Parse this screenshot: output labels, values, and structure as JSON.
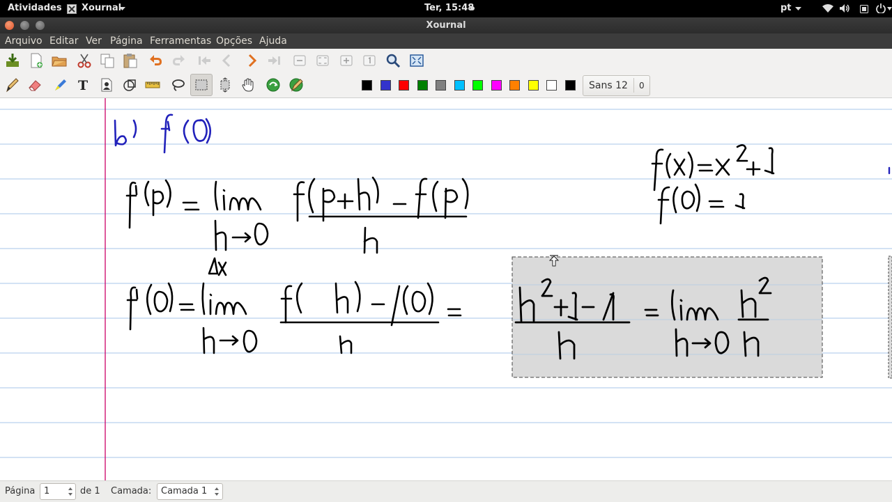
{
  "topbar": {
    "activities": "Atividades",
    "app_menu": "Xournal",
    "clock": "Ter, 15:48",
    "lang": "pt"
  },
  "window": {
    "title": "Xournal"
  },
  "menubar": {
    "items": [
      "Arquivo",
      "Editar",
      "Ver",
      "Página",
      "Ferramentas",
      "Opções",
      "Ajuda"
    ]
  },
  "toolbar1": {
    "icons": [
      "save-icon",
      "new-icon",
      "open-icon",
      "cut-icon",
      "copy-icon",
      "paste-icon",
      "undo-icon",
      "redo-icon",
      "first-page-icon",
      "previous-page-icon",
      "next-page-icon",
      "last-page-icon",
      "zoom-out-icon",
      "zoom-fit-icon",
      "zoom-in-icon",
      "zoom-normal-icon",
      "search-icon",
      "fullscreen-icon"
    ]
  },
  "toolbar2": {
    "tools": [
      "pen-icon",
      "eraser-icon",
      "highlighter-icon",
      "text-icon",
      "image-icon",
      "shape-icon",
      "ruler-icon",
      "lasso-select-icon",
      "rect-select-icon",
      "vertical-space-icon",
      "hand-icon",
      "default-tool-icon",
      "default-pen-icon"
    ],
    "active_tool": "rect-select-icon",
    "colors": [
      "#000000",
      "#3333cc",
      "#ff0000",
      "#008000",
      "#808080",
      "#00c0ff",
      "#00ff00",
      "#ff00ff",
      "#ff8000",
      "#ffff00",
      "#ffffff",
      "#000000"
    ],
    "font_name": "Sans 12",
    "font_size": "0"
  },
  "canvas": {
    "ink_color": "#000000",
    "ink_color_blue": "#2222bb",
    "line_color": "#a7c5e8",
    "margin_color": "#cc0066",
    "handwriting": [
      "b) f'(0)",
      "f'(p) = lim f(p+h) - f(p) / h",
      "h→0",
      "Δx",
      "f'(0) = lim f( h) - f(0) / h =",
      "h→0",
      "f(x)=x²+1",
      "f(0)=1",
      "h²+1 -1 / h = lim h² / h",
      "h→0"
    ]
  },
  "statusbar": {
    "page_label": "Página",
    "page_value": "1",
    "page_of": "de 1",
    "layer_label": "Camada:",
    "layer_value": "Camada 1"
  }
}
